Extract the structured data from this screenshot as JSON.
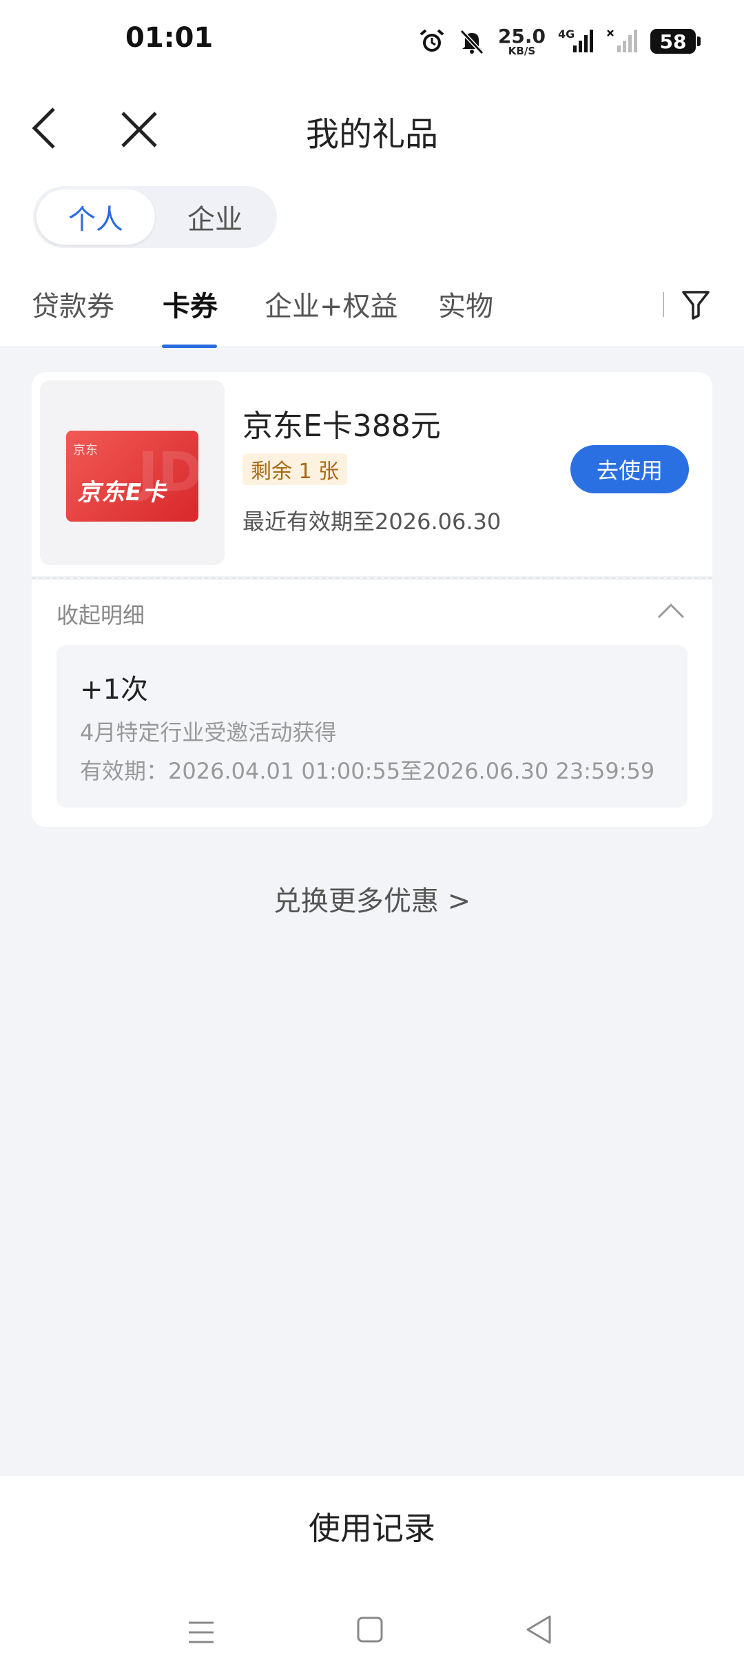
{
  "status_bar": {
    "time": "01:01",
    "net_speed_value": "25.0",
    "net_speed_unit": "KB/S",
    "network": "4G",
    "battery": "58"
  },
  "header": {
    "title": "我的礼品"
  },
  "segment": {
    "options": [
      "个人",
      "企业"
    ],
    "selected": "个人"
  },
  "tabs": {
    "items": [
      "贷款券",
      "卡券",
      "企业+权益",
      "实物"
    ],
    "active": "卡券"
  },
  "gift_card": {
    "image_small_text": "京东",
    "image_title": "京东E卡",
    "image_watermark": "JD",
    "name": "京东E卡388元",
    "remaining": "剩余 1 张",
    "expire": "最近有效期至2026.06.30",
    "use_button": "去使用"
  },
  "detail": {
    "collapse_label": "收起明细",
    "count": "+1次",
    "source": "4月特定行业受邀活动获得",
    "validity": "有效期：2026.04.01 01:00:55至2026.06.30 23:59:59"
  },
  "more_link": "兑换更多优惠 >",
  "bottom": {
    "usage_record": "使用记录"
  },
  "colors": {
    "accent": "#2a6be0",
    "button": "#2a70e2",
    "badge_bg": "#fdf2df",
    "badge_text": "#a86914",
    "page_bg": "#f3f4f8"
  }
}
